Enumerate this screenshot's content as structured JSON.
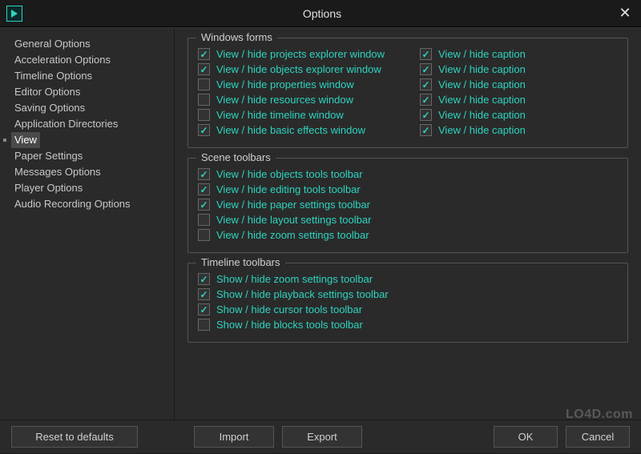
{
  "window": {
    "title": "Options"
  },
  "sidebar": {
    "items": [
      {
        "label": "General Options"
      },
      {
        "label": "Acceleration Options"
      },
      {
        "label": "Timeline Options"
      },
      {
        "label": "Editor Options"
      },
      {
        "label": "Saving Options"
      },
      {
        "label": "Application Directories"
      },
      {
        "label": "View"
      },
      {
        "label": "Paper Settings"
      },
      {
        "label": "Messages Options"
      },
      {
        "label": "Player Options"
      },
      {
        "label": "Audio Recording Options"
      }
    ],
    "selected_index": 6
  },
  "groups": {
    "windows_forms": {
      "title": "Windows forms",
      "left": [
        {
          "checked": true,
          "label": "View / hide projects explorer window"
        },
        {
          "checked": true,
          "label": "View / hide objects explorer window"
        },
        {
          "checked": false,
          "label": "View / hide properties window"
        },
        {
          "checked": false,
          "label": "View / hide resources window"
        },
        {
          "checked": false,
          "label": "View / hide timeline window"
        },
        {
          "checked": true,
          "label": "View / hide basic effects window"
        }
      ],
      "right": [
        {
          "checked": true,
          "label": "View / hide caption"
        },
        {
          "checked": true,
          "label": "View / hide caption"
        },
        {
          "checked": true,
          "label": "View / hide caption"
        },
        {
          "checked": true,
          "label": "View / hide caption"
        },
        {
          "checked": true,
          "label": "View / hide caption"
        },
        {
          "checked": true,
          "label": "View / hide caption"
        }
      ]
    },
    "scene_toolbars": {
      "title": "Scene toolbars",
      "items": [
        {
          "checked": true,
          "label": "View / hide objects tools toolbar"
        },
        {
          "checked": true,
          "label": "View / hide editing tools toolbar"
        },
        {
          "checked": true,
          "label": "View / hide paper settings toolbar"
        },
        {
          "checked": false,
          "label": "View / hide layout settings toolbar"
        },
        {
          "checked": false,
          "label": "View / hide zoom settings toolbar"
        }
      ]
    },
    "timeline_toolbars": {
      "title": "Timeline toolbars",
      "items": [
        {
          "checked": true,
          "label": "Show / hide zoom settings toolbar"
        },
        {
          "checked": true,
          "label": "Show / hide playback settings toolbar"
        },
        {
          "checked": true,
          "label": "Show / hide cursor tools toolbar"
        },
        {
          "checked": false,
          "label": "Show / hide blocks tools toolbar"
        }
      ]
    }
  },
  "footer": {
    "reset": "Reset to defaults",
    "import": "Import",
    "export": "Export",
    "ok": "OK",
    "cancel": "Cancel"
  },
  "watermark": "LO4D.com"
}
